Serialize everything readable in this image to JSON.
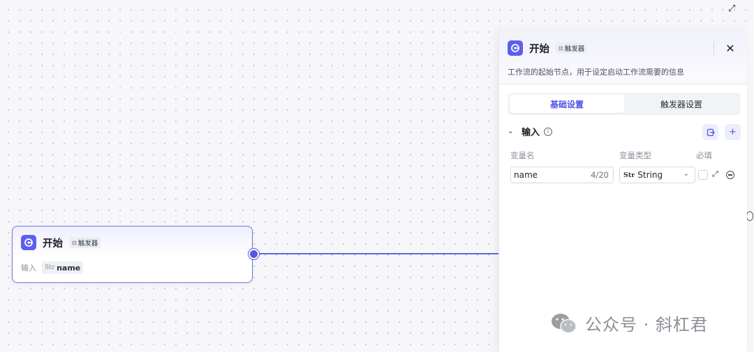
{
  "canvas_node": {
    "title": "开始",
    "tag_label": "触发器",
    "input_label": "输入",
    "variable_type_short": "Str",
    "variable_name": "name"
  },
  "panel": {
    "title": "开始",
    "tag_label": "触发器",
    "description": "工作流的起始节点，用于设定启动工作流需要的信息",
    "tabs": [
      {
        "label": "基础设置",
        "active": true
      },
      {
        "label": "触发器设置",
        "active": false
      }
    ],
    "section": {
      "title": "输入",
      "columns": {
        "name": "变量名",
        "type": "变量类型",
        "required": "必填"
      },
      "rows": [
        {
          "name": "name",
          "counter": "4/20",
          "type_short": "Str",
          "type": "String",
          "required": false
        }
      ]
    }
  },
  "icons": {
    "logo": "start-logo-icon",
    "close": "close-icon",
    "fullscreen": "fullscreen-icon",
    "import": "import-icon",
    "add": "plus-icon",
    "info": "info-icon",
    "collapse": "chevron-down-icon",
    "expand": "expand-arrows-icon",
    "remove": "minus-circle-icon"
  },
  "colors": {
    "accent": "#5b5ff0",
    "accent_text": "#4e54e6",
    "edge": "#6065e6"
  },
  "watermark": "公众号 · 斜杠君"
}
